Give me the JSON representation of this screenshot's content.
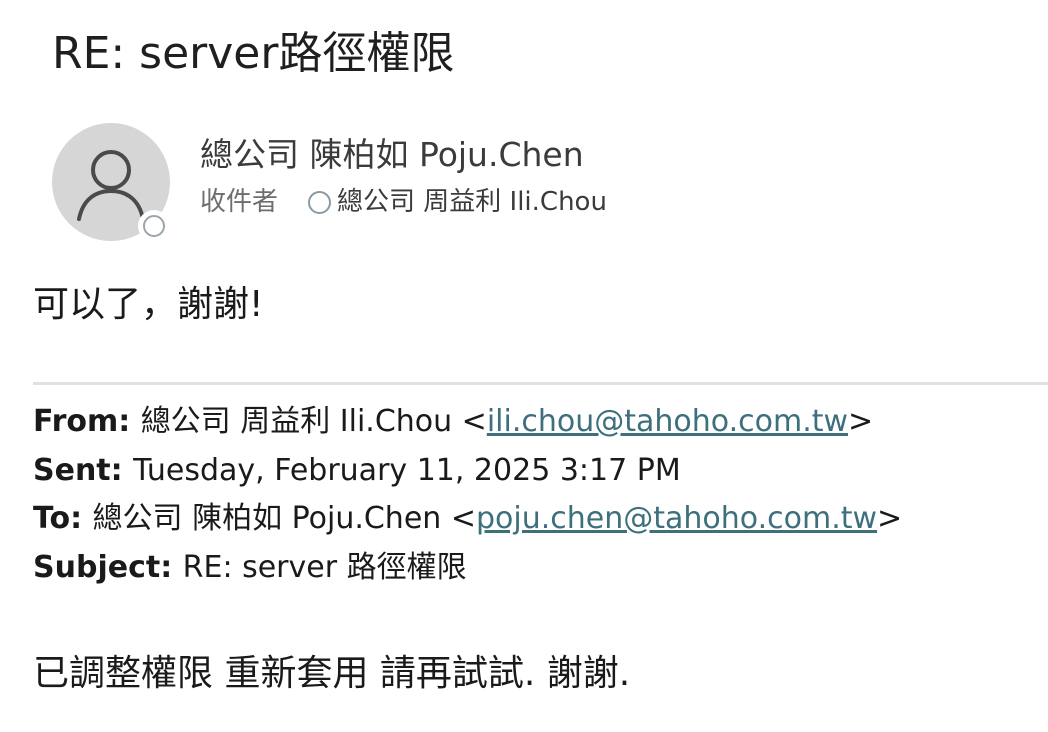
{
  "message": {
    "subject": "RE: server路徑權限",
    "sender_name": "總公司 陳柏如 Poju.Chen",
    "to_label": "收件者",
    "to_name": "總公司 周益利 Ili.Chou",
    "reply_body": "可以了，謝謝!"
  },
  "quoted": {
    "from_label": "From:",
    "from_name": "總公司 周益利 Ili.Chou <",
    "from_email": "ili.chou@tahoho.com.tw",
    "from_close": ">",
    "sent_label": "Sent:",
    "sent_value": "Tuesday, February 11, 2025 3:17 PM",
    "to_label": "To:",
    "to_name": "總公司 陳柏如 Poju.Chen <",
    "to_email": "poju.chen@tahoho.com.tw",
    "to_close": ">",
    "subject_label": "Subject:",
    "subject_value": "RE: server 路徑權限",
    "body": "已調整權限 重新套用 請再試試. 謝謝."
  },
  "icons": {
    "avatar": "person-silhouette-icon",
    "presence": "presence-unknown-icon"
  },
  "colors": {
    "link": "#3d6f7d",
    "avatar_bg": "#d6d6d6"
  }
}
